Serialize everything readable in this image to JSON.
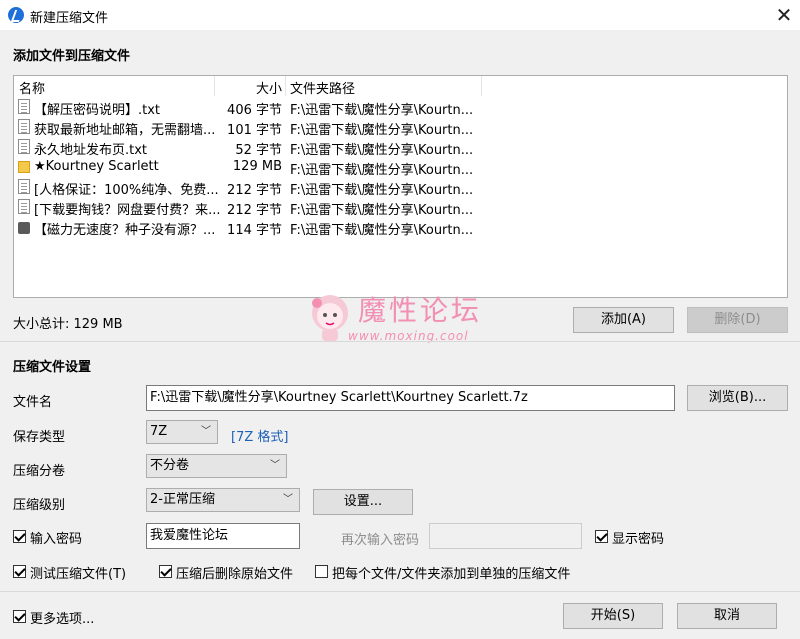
{
  "window": {
    "title": "新建压缩文件",
    "close_glyph": "✕"
  },
  "add_section": {
    "title": "添加文件到压缩文件"
  },
  "file_list": {
    "headers": {
      "name": "名称",
      "size": "大小",
      "path": "文件夹路径"
    },
    "rows": [
      {
        "icon": "document-icon",
        "name": "【解压密码说明】.txt",
        "size": "406 字节",
        "path": "F:\\迅雷下载\\魔性分享\\Kourtn..."
      },
      {
        "icon": "document-icon",
        "name": "获取最新地址邮箱，无需翻墙...",
        "size": "101 字节",
        "path": "F:\\迅雷下载\\魔性分享\\Kourtn..."
      },
      {
        "icon": "document-icon",
        "name": "永久地址发布页.txt",
        "size": "52 字节",
        "path": "F:\\迅雷下载\\魔性分享\\Kourtn..."
      },
      {
        "icon": "folder-icon",
        "name": "★Kourtney Scarlett",
        "size": "129 MB",
        "path": "F:\\迅雷下载\\魔性分享\\Kourtn..."
      },
      {
        "icon": "document-icon",
        "name": "[人格保证：100%纯净、免费...",
        "size": "212 字节",
        "path": "F:\\迅雷下载\\魔性分享\\Kourtn..."
      },
      {
        "icon": "document-icon",
        "name": "[下载要掏钱？网盘要付费？来...",
        "size": "212 字节",
        "path": "F:\\迅雷下载\\魔性分享\\Kourtn..."
      },
      {
        "icon": "torrent-icon",
        "name": "【磁力无速度？种子没有源？...",
        "size": "114 字节",
        "path": "F:\\迅雷下载\\魔性分享\\Kourtn..."
      }
    ]
  },
  "total_size": "大小总计: 129 MB",
  "buttons": {
    "add": "添加(A)",
    "delete": "删除(D)",
    "browse": "浏览(B)...",
    "settings": "设置...",
    "start": "开始(S)",
    "cancel": "取消"
  },
  "watermark": {
    "text": "魔性论坛",
    "url": "www.moxing.cool"
  },
  "settings_section": {
    "title": "压缩文件设置",
    "filename_label": "文件名",
    "filename_value": "F:\\迅雷下载\\魔性分享\\Kourtney Scarlett\\Kourtney Scarlett.7z",
    "save_type_label": "保存类型",
    "save_type_value": "7Z",
    "format_link": "[7Z 格式]",
    "split_label": "压缩分卷",
    "split_value": "不分卷",
    "level_label": "压缩级别",
    "level_value": "2-正常压缩",
    "password_checkbox": "输入密码",
    "password_value": "我爱魔性论坛",
    "reenter_label": "再次输入密码",
    "show_password": "显示密码",
    "test_archive": "测试压缩文件(T)",
    "delete_after": "压缩后删除原始文件",
    "each_separate": "把每个文件/文件夹添加到单独的压缩文件",
    "more_options": "更多选项..."
  },
  "colors": {
    "accent_link": "#1e5fb8",
    "watermark_pink": "#f28fb3"
  }
}
